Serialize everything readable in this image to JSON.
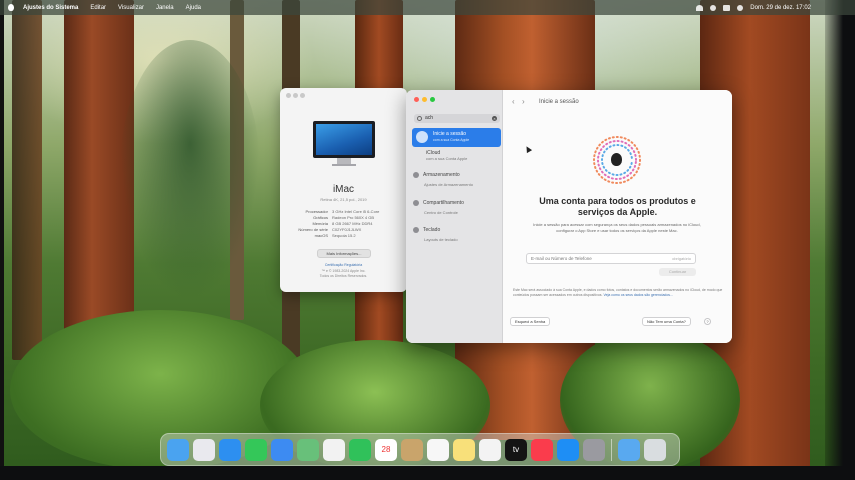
{
  "menubar": {
    "app_name": "Ajustes do Sistema",
    "items": [
      "Editar",
      "Visualizar",
      "Janela",
      "Ajuda"
    ],
    "datetime": "Dom. 29 de dez.  17:02"
  },
  "about_window": {
    "model": "iMac",
    "model_sub": "Retina 4K, 21,5 pol., 2019",
    "specs": [
      {
        "key": "Processador",
        "value": "3 GHz Intel Core i5 6-Core"
      },
      {
        "key": "Gráficos",
        "value": "Radeon Pro 560X 4 GB"
      },
      {
        "key": "Memória",
        "value": "8 GB 2667 MHz DDR4"
      },
      {
        "key": "Número de série",
        "value": "C02YF0J1JLWX"
      },
      {
        "key": "macOS",
        "value": "Sequoia 15.2"
      }
    ],
    "more_info_button": "Mais Informações...",
    "legal_link": "Certificação Regulatória",
    "legal_1": "™ e © 1983-2024 Apple Inc.",
    "legal_2": "Todos os Direitos Reservados."
  },
  "settings_window": {
    "search_value": "ach",
    "sidebar": {
      "selected_title": "Inicie a sessão",
      "selected_sub": "com a sua Conta Apple",
      "items": [
        {
          "title": "iCloud",
          "sub": "com a sua Conta Apple"
        },
        {
          "title": "Armazenamento",
          "sub": "Ajustes de Armazenamento"
        },
        {
          "title": "Compartilhamento",
          "sub": "Centro de Controle"
        },
        {
          "title": "Teclado",
          "sub": "Layouts de teclado"
        }
      ]
    },
    "pane": {
      "title": "Inicie a sessão",
      "headline": "Uma conta para todos os produtos e serviços da Apple.",
      "description": "Inicie a sessão para acessar com segurança os seus dados pessoais armazenados no iCloud, configurar o App Store e usar todos os serviços da Apple neste Mac.",
      "email_placeholder": "E-mail ou Número de Telefone",
      "email_hint": "obrigatório",
      "continue_button": "Continuar",
      "legal_text": "Este Mac será associado à sua Conta Apple, e dados como fotos, contatos e documentos serão armazenados no iCloud, de modo que conteúdos possam ser acessados em outros dispositivos.",
      "legal_link": "Veja como os seus dados são gerenciados...",
      "forgot_button": "Esqueci a Senha",
      "no_account_button": "Não Tem uma Conta?",
      "help_button": "?"
    }
  },
  "dock": {
    "icons": [
      {
        "name": "finder-icon",
        "color": "#4aa3f0"
      },
      {
        "name": "launchpad-icon",
        "color": "#e9e9ee"
      },
      {
        "name": "safari-icon",
        "color": "#2d8ff0"
      },
      {
        "name": "messages-icon",
        "color": "#34c759"
      },
      {
        "name": "mail-icon",
        "color": "#3d8bf2"
      },
      {
        "name": "maps-icon",
        "color": "#68c07a"
      },
      {
        "name": "photos-icon",
        "color": "#f2f2f2"
      },
      {
        "name": "facetime-icon",
        "color": "#30c15a"
      },
      {
        "name": "calendar-icon",
        "color": "#ffffff",
        "label": "28"
      },
      {
        "name": "contacts-icon",
        "color": "#c9a46b"
      },
      {
        "name": "reminders-icon",
        "color": "#f7f7f7"
      },
      {
        "name": "notes-icon",
        "color": "#f8e07a"
      },
      {
        "name": "freeform-icon",
        "color": "#f3f3f3"
      },
      {
        "name": "apple-tv-icon",
        "color": "#141414",
        "label": "tv"
      },
      {
        "name": "music-icon",
        "color": "#fa3c4c"
      },
      {
        "name": "app-store-icon",
        "color": "#1e8ef5"
      },
      {
        "name": "system-settings-icon",
        "color": "#9a9aa0"
      },
      {
        "name": "downloads-folder-icon",
        "color": "#59a9f0"
      },
      {
        "name": "trash-icon",
        "color": "#d9dde0"
      }
    ]
  }
}
